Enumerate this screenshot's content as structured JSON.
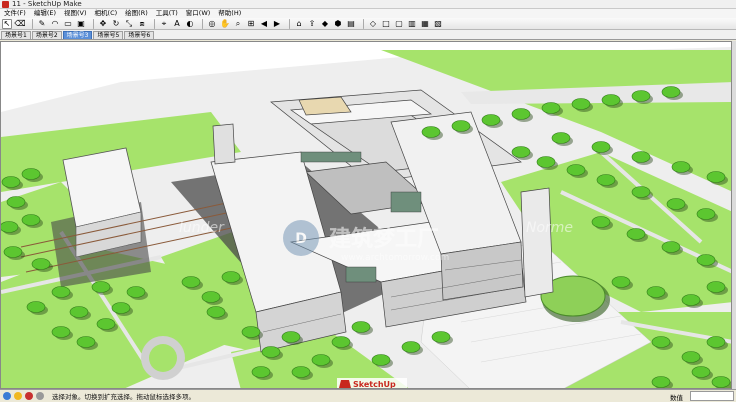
{
  "window": {
    "title": "11 - SketchUp Make"
  },
  "menu": {
    "items": [
      "文件(F)",
      "编辑(E)",
      "视图(V)",
      "相机(C)",
      "绘图(R)",
      "工具(T)",
      "窗口(W)",
      "帮助(H)"
    ]
  },
  "toolbar": {
    "tools": [
      {
        "name": "select-tool",
        "glyph": "↖",
        "boxed": true
      },
      {
        "name": "eraser-tool",
        "glyph": "⌫"
      },
      {
        "name": "pencil-tool",
        "glyph": "✎"
      },
      {
        "name": "arc-tool",
        "glyph": "◠"
      },
      {
        "name": "shape-tool",
        "glyph": "▭"
      },
      {
        "name": "pushpull-tool",
        "glyph": "▣"
      },
      {
        "name": "move-tool",
        "glyph": "✥"
      },
      {
        "name": "rotate-tool",
        "glyph": "↻"
      },
      {
        "name": "scale-tool",
        "glyph": "⤡"
      },
      {
        "name": "offset-tool",
        "glyph": "⧈"
      },
      {
        "name": "tape-tool",
        "glyph": "⌖"
      },
      {
        "name": "text-tool",
        "glyph": "A"
      },
      {
        "name": "paint-tool",
        "glyph": "◐"
      },
      {
        "name": "orbit-tool",
        "glyph": "◎"
      },
      {
        "name": "pan-tool",
        "glyph": "✋"
      },
      {
        "name": "zoom-tool",
        "glyph": "⌕"
      },
      {
        "name": "zoom-extents-tool",
        "glyph": "⊞"
      },
      {
        "name": "previous-view-tool",
        "glyph": "◀"
      },
      {
        "name": "next-view-tool",
        "glyph": "▶"
      },
      {
        "name": "warehouse-tool",
        "glyph": "⌂"
      },
      {
        "name": "share-tool",
        "glyph": "⇪"
      },
      {
        "name": "extension-tool",
        "glyph": "◆"
      },
      {
        "name": "component-tool",
        "glyph": "⬢"
      },
      {
        "name": "style-tool",
        "glyph": "▤"
      },
      {
        "name": "iso-view-tool",
        "glyph": "◇"
      },
      {
        "name": "top-view-tool",
        "glyph": "□"
      },
      {
        "name": "front-view-tool",
        "glyph": "▢"
      },
      {
        "name": "right-view-tool",
        "glyph": "▥"
      },
      {
        "name": "back-view-tool",
        "glyph": "▦"
      },
      {
        "name": "left-view-tool",
        "glyph": "▧"
      }
    ]
  },
  "scenes": {
    "tabs": [
      {
        "label": "场景号1",
        "active": false
      },
      {
        "label": "场景号2",
        "active": false
      },
      {
        "label": "场景号3",
        "active": true
      },
      {
        "label": "场景号5",
        "active": false
      },
      {
        "label": "场景号6",
        "active": false
      }
    ]
  },
  "viewport": {
    "watermark_cn": "建筑梦工厂",
    "watermark_url": "www.archtomorrow.com",
    "watermark_left": "lunder",
    "watermark_right": "Norme"
  },
  "status": {
    "text": "选择对象。切换到扩充选择。拖动鼠标选择多项。",
    "measure_label": "数值",
    "measure_value": "",
    "logo_text": "SketchUp",
    "logo_url": "sketchupbar.com"
  },
  "colors": {
    "grass": "#a6e36b",
    "tree": "#5cc630",
    "path": "#efefef",
    "building": "#f3f3f3",
    "shadow": "#4a4a4a",
    "accent": "#c8281e"
  }
}
